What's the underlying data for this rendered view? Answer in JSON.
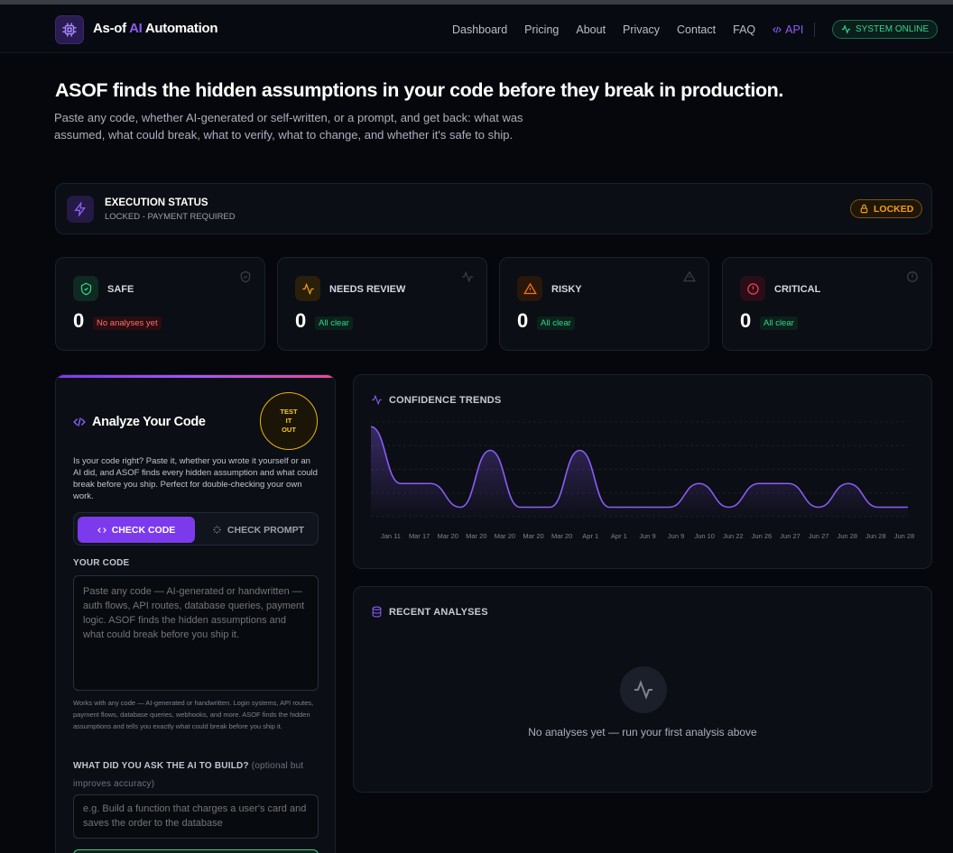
{
  "nav": {
    "brand_prefix": "As-of ",
    "brand_ai": "AI",
    "brand_suffix": " Automation",
    "links": [
      "Dashboard",
      "Pricing",
      "About",
      "Privacy",
      "Contact",
      "FAQ"
    ],
    "api_label": "API",
    "system_status": "SYSTEM ONLINE"
  },
  "hero": {
    "title": "ASOF finds the hidden assumptions in your code before they break in production.",
    "subtitle": "Paste any code, whether AI-generated or self-written, or a prompt, and get back: what was assumed, what could break, what to verify, what to change, and whether it's safe to ship."
  },
  "execution": {
    "title": "EXECUTION STATUS",
    "subtitle": "LOCKED - PAYMENT REQUIRED",
    "badge": "LOCKED"
  },
  "stats": [
    {
      "label": "SAFE",
      "value": "0",
      "note": "No analyses yet",
      "tone": "red",
      "color": "#34d399",
      "bg": "#0f2a20"
    },
    {
      "label": "NEEDS REVIEW",
      "value": "0",
      "note": "All clear",
      "tone": "green",
      "color": "#f59e0b",
      "bg": "#2a1f0b"
    },
    {
      "label": "RISKY",
      "value": "0",
      "note": "All clear",
      "tone": "green",
      "color": "#f97316",
      "bg": "#2a170b"
    },
    {
      "label": "CRITICAL",
      "value": "0",
      "note": "All clear",
      "tone": "green",
      "color": "#f43f5e",
      "bg": "#2a0d16"
    }
  ],
  "analyze": {
    "title": "Analyze Your Code",
    "test_badge": "TEST\nIT\nOUT",
    "description": "Is your code right? Paste it, whether you wrote it yourself or an AI did, and ASOF finds every hidden assumption and what could break before you ship. Perfect for double-checking your own work.",
    "tab_code": "CHECK CODE",
    "tab_prompt": "CHECK PROMPT",
    "code_label": "YOUR CODE",
    "code_placeholder": "Paste any code — AI-generated or handwritten — auth flows, API routes, database queries, payment logic. ASOF finds the hidden assumptions and what could break before you ship it.",
    "help": "Works with any code — AI-generated or handwritten. Login systems, API routes, payment flows, database queries, webhooks, and more. ASOF finds the hidden assumptions and tells you exactly what could break before you ship it.",
    "prompt_label": "WHAT DID YOU ASK THE AI TO BUILD?",
    "prompt_optional": "(optional but improves accuracy)",
    "prompt_placeholder": "e.g. Build a function that charges a user's card and saves the order to the database"
  },
  "chart_data": {
    "type": "area",
    "title": "CONFIDENCE TRENDS",
    "categories": [
      "Jan 11",
      "Mar 17",
      "Mar 20",
      "Mar 20",
      "Mar 20",
      "Mar 20",
      "Mar 20",
      "Apr 1",
      "Apr 1",
      "Jun 9",
      "Jun 9",
      "Jun 10",
      "Jun 22",
      "Jun 26",
      "Jun 27",
      "Jun 27",
      "Jun 28",
      "Jun 28",
      "Jun 28"
    ],
    "values": [
      95,
      35,
      35,
      10,
      70,
      10,
      10,
      70,
      10,
      10,
      10,
      35,
      10,
      35,
      35,
      10,
      35,
      10,
      10
    ],
    "series_color": "#8b5cf6",
    "grid": true
  },
  "recent": {
    "title": "RECENT ANALYSES",
    "empty": "No analyses yet — run your first analysis above"
  }
}
